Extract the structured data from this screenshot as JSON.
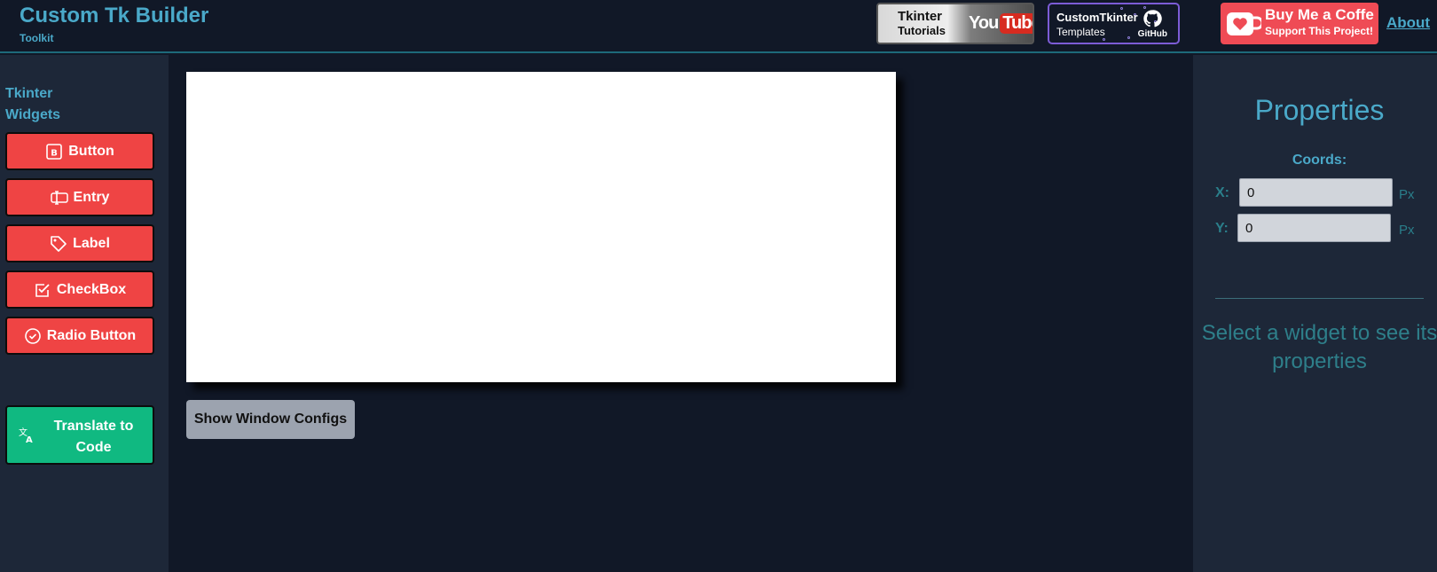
{
  "header": {
    "title": "Custom Tk Builder",
    "subtitle": "Toolkit",
    "youtube_badge": {
      "line1": "Tkinter",
      "line2": "Tutorials",
      "you": "You",
      "tube": "Tube"
    },
    "github_badge": {
      "line1": "CustomTkinter",
      "line2": "Templates",
      "label": "GitHub"
    },
    "bmc_badge": {
      "line1": "Buy Me a Coffe",
      "line2": "Support This Project!"
    },
    "about_label": "About"
  },
  "sidebar": {
    "title": "Tkinter Widgets",
    "items": [
      {
        "label": "Button",
        "icon": "button-icon"
      },
      {
        "label": "Entry",
        "icon": "entry-icon"
      },
      {
        "label": "Label",
        "icon": "tag-icon"
      },
      {
        "label": "CheckBox",
        "icon": "checkbox-icon"
      },
      {
        "label": "Radio Button",
        "icon": "radio-icon"
      }
    ],
    "translate_label": "Translate to Code"
  },
  "main": {
    "config_button_label": "Show Window Configs"
  },
  "properties": {
    "title": "Properties",
    "coords_label": "Coords:",
    "x_label": "X:",
    "y_label": "Y:",
    "x_value": "0",
    "y_value": "0",
    "unit": "Px",
    "hint": "Select a widget to see its properties"
  },
  "colors": {
    "accent": "#4aa9c9",
    "widget_button": "#ef4444",
    "translate_button": "#10b981",
    "background": "#111827",
    "panel": "#1d2738"
  }
}
